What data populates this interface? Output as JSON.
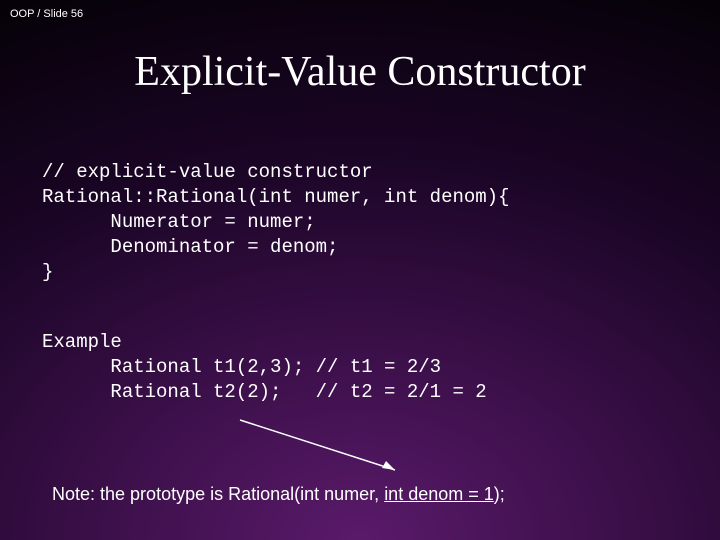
{
  "header": "OOP / Slide 56",
  "title": "Explicit-Value Constructor",
  "code": {
    "l1": "// explicit-value constructor",
    "l2": "Rational::Rational(int numer, int denom){",
    "l3": "      Numerator = numer;",
    "l4": "      Denominator = denom;",
    "l5": "}"
  },
  "example": {
    "l1": "Example",
    "l2": "      Rational t1(2,3); // t1 = 2/3",
    "l3": "      Rational t2(2);   // t2 = 2/1 = 2"
  },
  "note": {
    "prefix": "Note:  the prototype is Rational(int numer, ",
    "underlined": "int denom = 1",
    "suffix": ");"
  }
}
